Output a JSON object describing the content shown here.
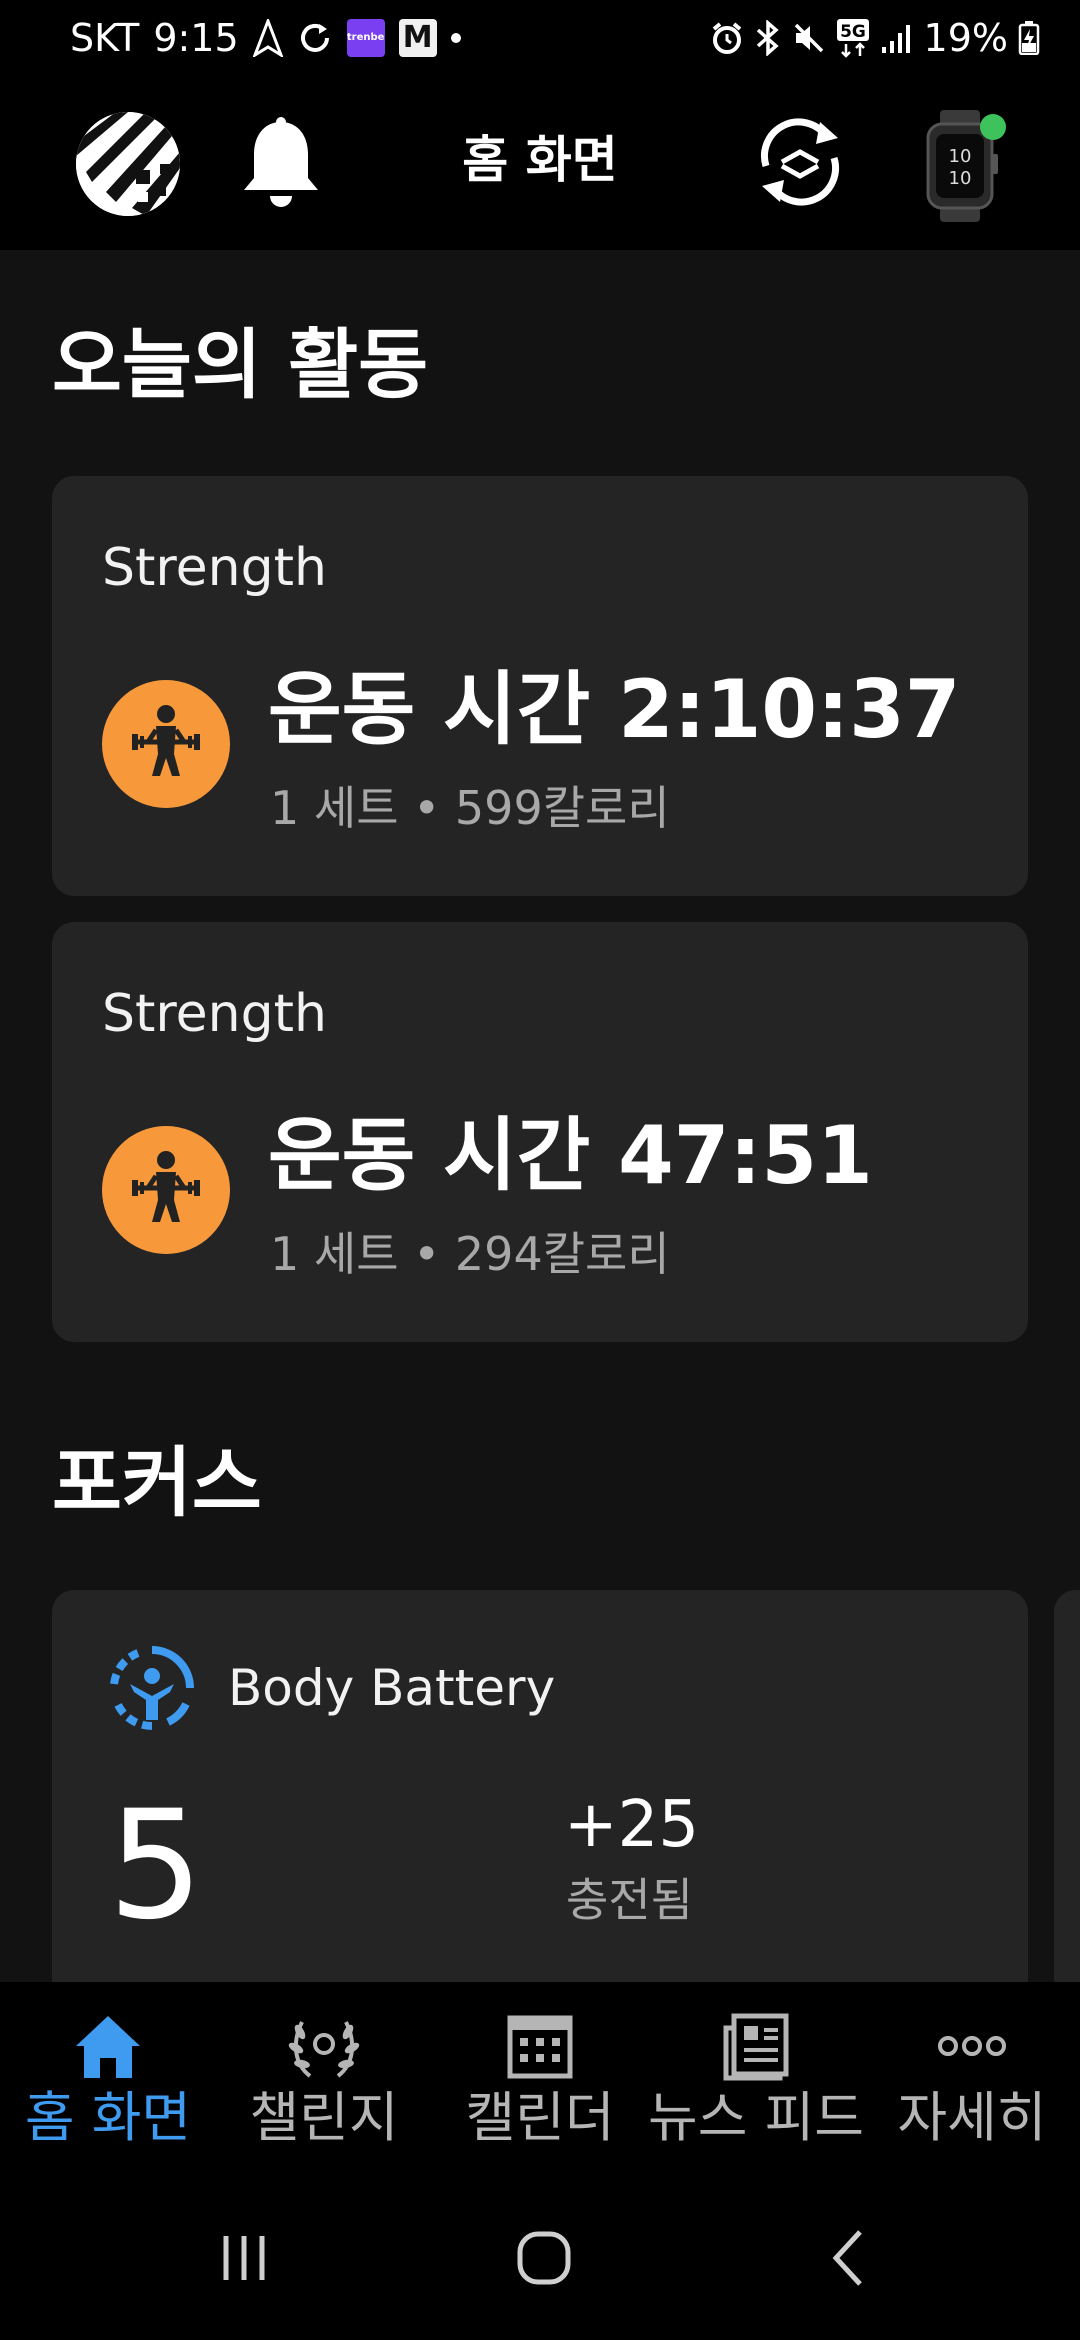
{
  "status_bar": {
    "carrier": "SKT",
    "time": "9:15",
    "app_chip_1": "trenbe",
    "app_chip_2": "M",
    "network_label": "5G",
    "battery_percent": "19%"
  },
  "app_bar": {
    "title": "홈 화면"
  },
  "activity": {
    "title": "오늘의 활동",
    "items": [
      {
        "label": "Strength",
        "main": "운동 시간 2:10:37",
        "sub": "1 세트 • 599칼로리"
      },
      {
        "label": "Strength",
        "main": "운동 시간 47:51",
        "sub": "1 세트 • 294칼로리"
      }
    ]
  },
  "focus": {
    "title": "포커스",
    "body_battery": {
      "label": "Body Battery",
      "value": "5",
      "delta": "+25",
      "delta_label": "충전됨"
    }
  },
  "bottom_nav": {
    "items": [
      {
        "label": "홈 화면",
        "icon": "home-icon",
        "active": true
      },
      {
        "label": "챌린지",
        "icon": "laurel-icon",
        "active": false
      },
      {
        "label": "캘린더",
        "icon": "calendar-icon",
        "active": false
      },
      {
        "label": "뉴스 피드",
        "icon": "news-icon",
        "active": false
      },
      {
        "label": "자세히",
        "icon": "more-icon",
        "active": false
      }
    ]
  },
  "colors": {
    "background": "#121212",
    "card": "#242424",
    "accent_orange": "#f7993b",
    "accent_blue": "#3f9bf0",
    "connected_green": "#3ec25b",
    "secondary_text": "#a8a8a8"
  }
}
